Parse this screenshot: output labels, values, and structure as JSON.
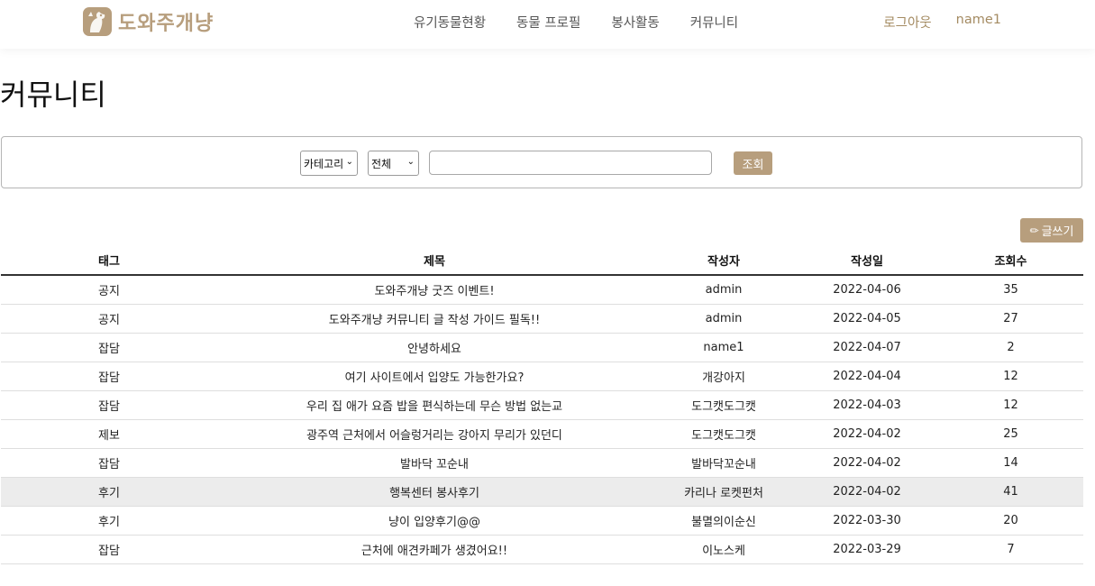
{
  "header": {
    "logo_text": "도와주개냥",
    "nav": [
      "유기동물현황",
      "동물 프로필",
      "봉사활동",
      "커뮤니티"
    ],
    "logout": "로그아웃",
    "username": "name1"
  },
  "page": {
    "title": "커뮤니티"
  },
  "search": {
    "category_select": "카테고리",
    "scope_select": "전체",
    "input_value": "",
    "button_label": "조회"
  },
  "write_button": "글쓰기",
  "table": {
    "headers": [
      "태그",
      "제목",
      "작성자",
      "작성일",
      "조회수"
    ],
    "rows": [
      {
        "tag": "공지",
        "title": "도와주개냥 굿즈 이벤트!",
        "author": "admin",
        "date": "2022-04-06",
        "views": "35"
      },
      {
        "tag": "공지",
        "title": "도와주개냥 커뮤니티 글 작성 가이드 필독!!",
        "author": "admin",
        "date": "2022-04-05",
        "views": "27"
      },
      {
        "tag": "잡담",
        "title": "안녕하세요",
        "author": "name1",
        "date": "2022-04-07",
        "views": "2"
      },
      {
        "tag": "잡담",
        "title": "여기 사이트에서 입양도 가능한가요?",
        "author": "개강아지",
        "date": "2022-04-04",
        "views": "12"
      },
      {
        "tag": "잡담",
        "title": "우리 집 애가 요즘 밥을 편식하는데 무슨 방법 없는교",
        "author": "도그캣도그캣",
        "date": "2022-04-03",
        "views": "12"
      },
      {
        "tag": "제보",
        "title": "광주역 근처에서 어슬렁거리는 강아지 무리가 있던디",
        "author": "도그캣도그캣",
        "date": "2022-04-02",
        "views": "25"
      },
      {
        "tag": "잡담",
        "title": "발바닥 꼬순내",
        "author": "발바닥꼬순내",
        "date": "2022-04-02",
        "views": "14"
      },
      {
        "tag": "후기",
        "title": "행복센터 봉사후기",
        "author": "카리나 로켓펀처",
        "date": "2022-04-02",
        "views": "41"
      },
      {
        "tag": "후기",
        "title": "냥이 입양후기@@",
        "author": "불멸의이순신",
        "date": "2022-03-30",
        "views": "20"
      },
      {
        "tag": "잡담",
        "title": "근처에 애견카페가 생겼어요!!",
        "author": "이노스케",
        "date": "2022-03-29",
        "views": "7"
      }
    ]
  },
  "colors": {
    "accent": "#b79e7d",
    "auth_text": "#a48b62",
    "row_highlight": "#ececec"
  },
  "icons": {
    "logo": "dog-cat-logo-icon",
    "write": "pencil-icon",
    "select_arrow": "chevron-down-icon"
  }
}
